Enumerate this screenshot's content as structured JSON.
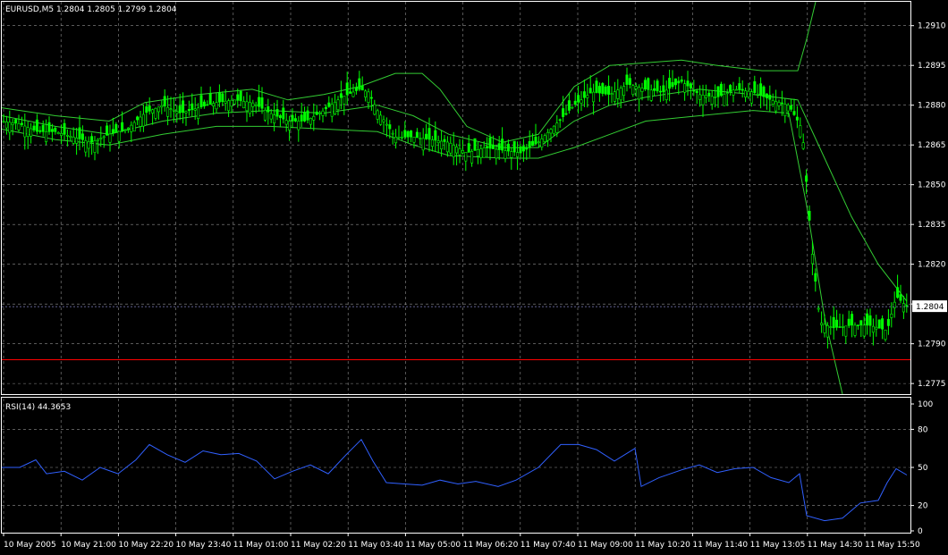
{
  "chart_data": [
    {
      "type": "candlestick",
      "title": "EURUSD,M5  1.2804 1.2805 1.2799 1.2804",
      "symbol": "EURUSD",
      "timeframe": "M5",
      "ohlc_last": {
        "open": 1.2804,
        "high": 1.2805,
        "low": 1.2799,
        "close": 1.2804
      },
      "current_price_label": "1.2804",
      "current_price": 1.2804,
      "ylim": [
        1.2771,
        1.2919
      ],
      "y_ticks": [
        1.291,
        1.2895,
        1.288,
        1.2865,
        1.285,
        1.2835,
        1.282,
        1.2805,
        1.279,
        1.2775
      ],
      "y_tick_labels": [
        "1.2910",
        "1.2895",
        "1.2880",
        "1.2865",
        "1.2850",
        "1.2835",
        "1.2820",
        "1.2805",
        "1.2790",
        "1.2775"
      ],
      "horizontal_line": {
        "value": 1.2784,
        "color": "#ff0000"
      },
      "price_series": [
        {
          "x": 0,
          "y": 1.2874
        },
        {
          "x": 20,
          "y": 1.2873
        },
        {
          "x": 40,
          "y": 1.287
        },
        {
          "x": 60,
          "y": 1.287
        },
        {
          "x": 80,
          "y": 1.2868
        },
        {
          "x": 100,
          "y": 1.2866
        },
        {
          "x": 120,
          "y": 1.2869
        },
        {
          "x": 140,
          "y": 1.2871
        },
        {
          "x": 160,
          "y": 1.2877
        },
        {
          "x": 180,
          "y": 1.288
        },
        {
          "x": 200,
          "y": 1.2877
        },
        {
          "x": 220,
          "y": 1.2879
        },
        {
          "x": 240,
          "y": 1.2881
        },
        {
          "x": 260,
          "y": 1.2882
        },
        {
          "x": 280,
          "y": 1.2881
        },
        {
          "x": 300,
          "y": 1.2877
        },
        {
          "x": 320,
          "y": 1.2874
        },
        {
          "x": 340,
          "y": 1.2874
        },
        {
          "x": 360,
          "y": 1.2878
        },
        {
          "x": 380,
          "y": 1.2883
        },
        {
          "x": 400,
          "y": 1.2886
        },
        {
          "x": 410,
          "y": 1.2885
        },
        {
          "x": 420,
          "y": 1.2878
        },
        {
          "x": 440,
          "y": 1.2868
        },
        {
          "x": 460,
          "y": 1.2868
        },
        {
          "x": 480,
          "y": 1.2867
        },
        {
          "x": 500,
          "y": 1.2866
        },
        {
          "x": 520,
          "y": 1.2862
        },
        {
          "x": 540,
          "y": 1.2864
        },
        {
          "x": 560,
          "y": 1.2863
        },
        {
          "x": 580,
          "y": 1.2862
        },
        {
          "x": 600,
          "y": 1.2866
        },
        {
          "x": 620,
          "y": 1.2873
        },
        {
          "x": 640,
          "y": 1.288
        },
        {
          "x": 660,
          "y": 1.2885
        },
        {
          "x": 680,
          "y": 1.2884
        },
        {
          "x": 700,
          "y": 1.2888
        },
        {
          "x": 720,
          "y": 1.2886
        },
        {
          "x": 740,
          "y": 1.2885
        },
        {
          "x": 760,
          "y": 1.2889
        },
        {
          "x": 780,
          "y": 1.2884
        },
        {
          "x": 800,
          "y": 1.2883
        },
        {
          "x": 820,
          "y": 1.2886
        },
        {
          "x": 840,
          "y": 1.2885
        },
        {
          "x": 860,
          "y": 1.2882
        },
        {
          "x": 880,
          "y": 1.288
        },
        {
          "x": 895,
          "y": 1.2871
        },
        {
          "x": 905,
          "y": 1.2828
        },
        {
          "x": 915,
          "y": 1.2798
        },
        {
          "x": 930,
          "y": 1.2796
        },
        {
          "x": 950,
          "y": 1.2797
        },
        {
          "x": 970,
          "y": 1.2797
        },
        {
          "x": 990,
          "y": 1.2795
        },
        {
          "x": 1000,
          "y": 1.2808
        },
        {
          "x": 1012,
          "y": 1.2804
        }
      ],
      "bollinger_upper": [
        {
          "x": 0,
          "y": 1.2879
        },
        {
          "x": 60,
          "y": 1.2876
        },
        {
          "x": 120,
          "y": 1.2874
        },
        {
          "x": 160,
          "y": 1.2881
        },
        {
          "x": 220,
          "y": 1.2884
        },
        {
          "x": 280,
          "y": 1.2886
        },
        {
          "x": 320,
          "y": 1.2882
        },
        {
          "x": 360,
          "y": 1.2884
        },
        {
          "x": 400,
          "y": 1.2887
        },
        {
          "x": 440,
          "y": 1.2892
        },
        {
          "x": 470,
          "y": 1.2892
        },
        {
          "x": 490,
          "y": 1.2886
        },
        {
          "x": 520,
          "y": 1.2872
        },
        {
          "x": 560,
          "y": 1.2866
        },
        {
          "x": 600,
          "y": 1.2869
        },
        {
          "x": 640,
          "y": 1.2887
        },
        {
          "x": 680,
          "y": 1.2895
        },
        {
          "x": 720,
          "y": 1.2896
        },
        {
          "x": 760,
          "y": 1.2897
        },
        {
          "x": 800,
          "y": 1.2895
        },
        {
          "x": 850,
          "y": 1.2893
        },
        {
          "x": 890,
          "y": 1.2893
        },
        {
          "x": 900,
          "y": 1.2905
        },
        {
          "x": 910,
          "y": 1.2919
        }
      ],
      "bollinger_middle": [
        {
          "x": 0,
          "y": 1.2876
        },
        {
          "x": 60,
          "y": 1.2872
        },
        {
          "x": 120,
          "y": 1.2869
        },
        {
          "x": 180,
          "y": 1.2874
        },
        {
          "x": 240,
          "y": 1.2877
        },
        {
          "x": 300,
          "y": 1.2878
        },
        {
          "x": 360,
          "y": 1.2877
        },
        {
          "x": 420,
          "y": 1.288
        },
        {
          "x": 460,
          "y": 1.2876
        },
        {
          "x": 500,
          "y": 1.2869
        },
        {
          "x": 560,
          "y": 1.2864
        },
        {
          "x": 600,
          "y": 1.2864
        },
        {
          "x": 640,
          "y": 1.2874
        },
        {
          "x": 680,
          "y": 1.288
        },
        {
          "x": 720,
          "y": 1.2883
        },
        {
          "x": 780,
          "y": 1.2886
        },
        {
          "x": 840,
          "y": 1.2884
        },
        {
          "x": 890,
          "y": 1.2882
        },
        {
          "x": 920,
          "y": 1.286
        },
        {
          "x": 950,
          "y": 1.2838
        },
        {
          "x": 980,
          "y": 1.282
        },
        {
          "x": 1012,
          "y": 1.2806
        }
      ],
      "bollinger_lower": [
        {
          "x": 0,
          "y": 1.2871
        },
        {
          "x": 60,
          "y": 1.2867
        },
        {
          "x": 120,
          "y": 1.2865
        },
        {
          "x": 180,
          "y": 1.2869
        },
        {
          "x": 240,
          "y": 1.2872
        },
        {
          "x": 300,
          "y": 1.2872
        },
        {
          "x": 360,
          "y": 1.2871
        },
        {
          "x": 420,
          "y": 1.287
        },
        {
          "x": 460,
          "y": 1.2865
        },
        {
          "x": 500,
          "y": 1.2861
        },
        {
          "x": 560,
          "y": 1.286
        },
        {
          "x": 600,
          "y": 1.286
        },
        {
          "x": 640,
          "y": 1.2864
        },
        {
          "x": 680,
          "y": 1.2869
        },
        {
          "x": 720,
          "y": 1.2874
        },
        {
          "x": 780,
          "y": 1.2876
        },
        {
          "x": 840,
          "y": 1.2878
        },
        {
          "x": 880,
          "y": 1.2877
        },
        {
          "x": 900,
          "y": 1.2842
        },
        {
          "x": 920,
          "y": 1.28
        },
        {
          "x": 940,
          "y": 1.2771
        }
      ],
      "candle_color": "#00ff00",
      "band_color": "#33cc33",
      "grid": true,
      "grid_color": "#c0c0c0"
    },
    {
      "type": "line",
      "title": "RSI(14) 44.3653",
      "indicator": "RSI(14)",
      "value": 44.3653,
      "ylim": [
        0,
        100
      ],
      "y_ticks": [
        100,
        80,
        50,
        20,
        0
      ],
      "y_tick_labels": [
        "100",
        "80",
        "50",
        "20",
        "0"
      ],
      "series": [
        {
          "color": "#3060ff",
          "points": [
            {
              "x": 0,
              "y": 50
            },
            {
              "x": 20,
              "y": 50
            },
            {
              "x": 38,
              "y": 56
            },
            {
              "x": 50,
              "y": 45
            },
            {
              "x": 70,
              "y": 47
            },
            {
              "x": 90,
              "y": 40
            },
            {
              "x": 110,
              "y": 50
            },
            {
              "x": 130,
              "y": 45
            },
            {
              "x": 150,
              "y": 56
            },
            {
              "x": 165,
              "y": 68
            },
            {
              "x": 185,
              "y": 60
            },
            {
              "x": 205,
              "y": 54
            },
            {
              "x": 225,
              "y": 63
            },
            {
              "x": 245,
              "y": 60
            },
            {
              "x": 265,
              "y": 61
            },
            {
              "x": 285,
              "y": 55
            },
            {
              "x": 305,
              "y": 41
            },
            {
              "x": 325,
              "y": 47
            },
            {
              "x": 345,
              "y": 52
            },
            {
              "x": 365,
              "y": 45
            },
            {
              "x": 385,
              "y": 60
            },
            {
              "x": 402,
              "y": 72
            },
            {
              "x": 415,
              "y": 55
            },
            {
              "x": 430,
              "y": 38
            },
            {
              "x": 450,
              "y": 37
            },
            {
              "x": 470,
              "y": 36
            },
            {
              "x": 490,
              "y": 40
            },
            {
              "x": 510,
              "y": 37
            },
            {
              "x": 530,
              "y": 39
            },
            {
              "x": 555,
              "y": 35
            },
            {
              "x": 575,
              "y": 40
            },
            {
              "x": 600,
              "y": 50
            },
            {
              "x": 625,
              "y": 68
            },
            {
              "x": 645,
              "y": 68
            },
            {
              "x": 665,
              "y": 64
            },
            {
              "x": 685,
              "y": 55
            },
            {
              "x": 708,
              "y": 65
            },
            {
              "x": 715,
              "y": 35
            },
            {
              "x": 735,
              "y": 42
            },
            {
              "x": 760,
              "y": 48
            },
            {
              "x": 780,
              "y": 52
            },
            {
              "x": 800,
              "y": 46
            },
            {
              "x": 820,
              "y": 49
            },
            {
              "x": 840,
              "y": 50
            },
            {
              "x": 860,
              "y": 42
            },
            {
              "x": 880,
              "y": 38
            },
            {
              "x": 892,
              "y": 45
            },
            {
              "x": 900,
              "y": 12
            },
            {
              "x": 920,
              "y": 8
            },
            {
              "x": 940,
              "y": 10
            },
            {
              "x": 960,
              "y": 22
            },
            {
              "x": 980,
              "y": 24
            },
            {
              "x": 990,
              "y": 38
            },
            {
              "x": 1000,
              "y": 49
            },
            {
              "x": 1012,
              "y": 44
            }
          ]
        }
      ],
      "grid": true
    }
  ],
  "x_axis_labels": [
    "10 May 2005",
    "10 May 21:00",
    "10 May 22:20",
    "10 May 23:40",
    "11 May 01:00",
    "11 May 02:20",
    "11 May 03:40",
    "11 May 05:00",
    "11 May 06:20",
    "11 May 07:40",
    "11 May 09:00",
    "11 May 10:20",
    "11 May 11:40",
    "11 May 13:05",
    "11 May 14:30",
    "11 May 15:50"
  ],
  "colors": {
    "background": "#000000",
    "frame": "#ffffff",
    "text": "#ffffff"
  }
}
